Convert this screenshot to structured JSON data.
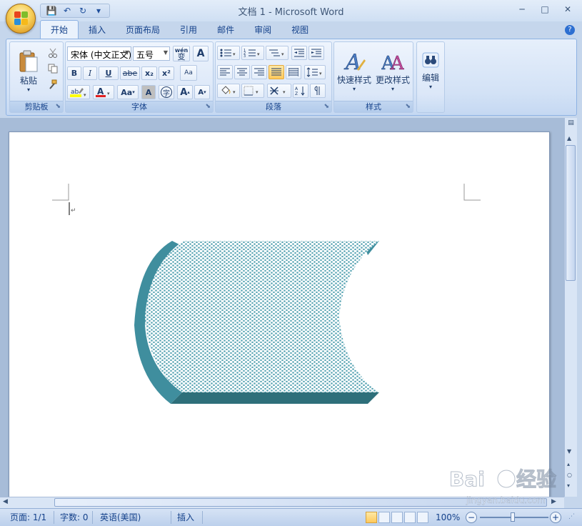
{
  "window": {
    "title": "文档 1 - Microsoft Word",
    "minimize": "─",
    "maximize": "□",
    "close": "✕"
  },
  "qat": {
    "save": "💾",
    "undo": "↶",
    "redo": "↻",
    "more": "▾"
  },
  "tabs": [
    {
      "label": "开始",
      "active": true
    },
    {
      "label": "插入"
    },
    {
      "label": "页面布局"
    },
    {
      "label": "引用"
    },
    {
      "label": "邮件"
    },
    {
      "label": "审阅"
    },
    {
      "label": "视图"
    }
  ],
  "help": "?",
  "ribbon": {
    "clipboard": {
      "label": "剪贴板",
      "paste": "粘贴",
      "paste_dd": "▾"
    },
    "font": {
      "label": "字体",
      "font_name": "宋体 (中文正文)",
      "font_size": "五号",
      "bold": "B",
      "italic": "I",
      "underline": "U",
      "strike": "abe",
      "subscript": "x₂",
      "superscript": "x²",
      "grow": "A",
      "shrink": "A",
      "case": "Aa",
      "char_shade": "A",
      "enclose": "字",
      "phonetic": "wén",
      "phonetic_char": "变",
      "border_char": "A",
      "clear": "Aa"
    },
    "paragraph": {
      "label": "段落"
    },
    "styles": {
      "label": "样式",
      "quick": "快速样式",
      "change": "更改样式"
    },
    "editing": {
      "label": "编辑"
    }
  },
  "status": {
    "page": "页面: 1/1",
    "words": "字数: 0",
    "language": "英语(美国)",
    "insert": "插入",
    "zoom": "100%",
    "zoom_out": "−",
    "zoom_in": "+"
  },
  "colors": {
    "shape_front": "#5aa5b4",
    "shape_side": "#3f8e9e",
    "shape_bottom": "#2e6f7a"
  }
}
